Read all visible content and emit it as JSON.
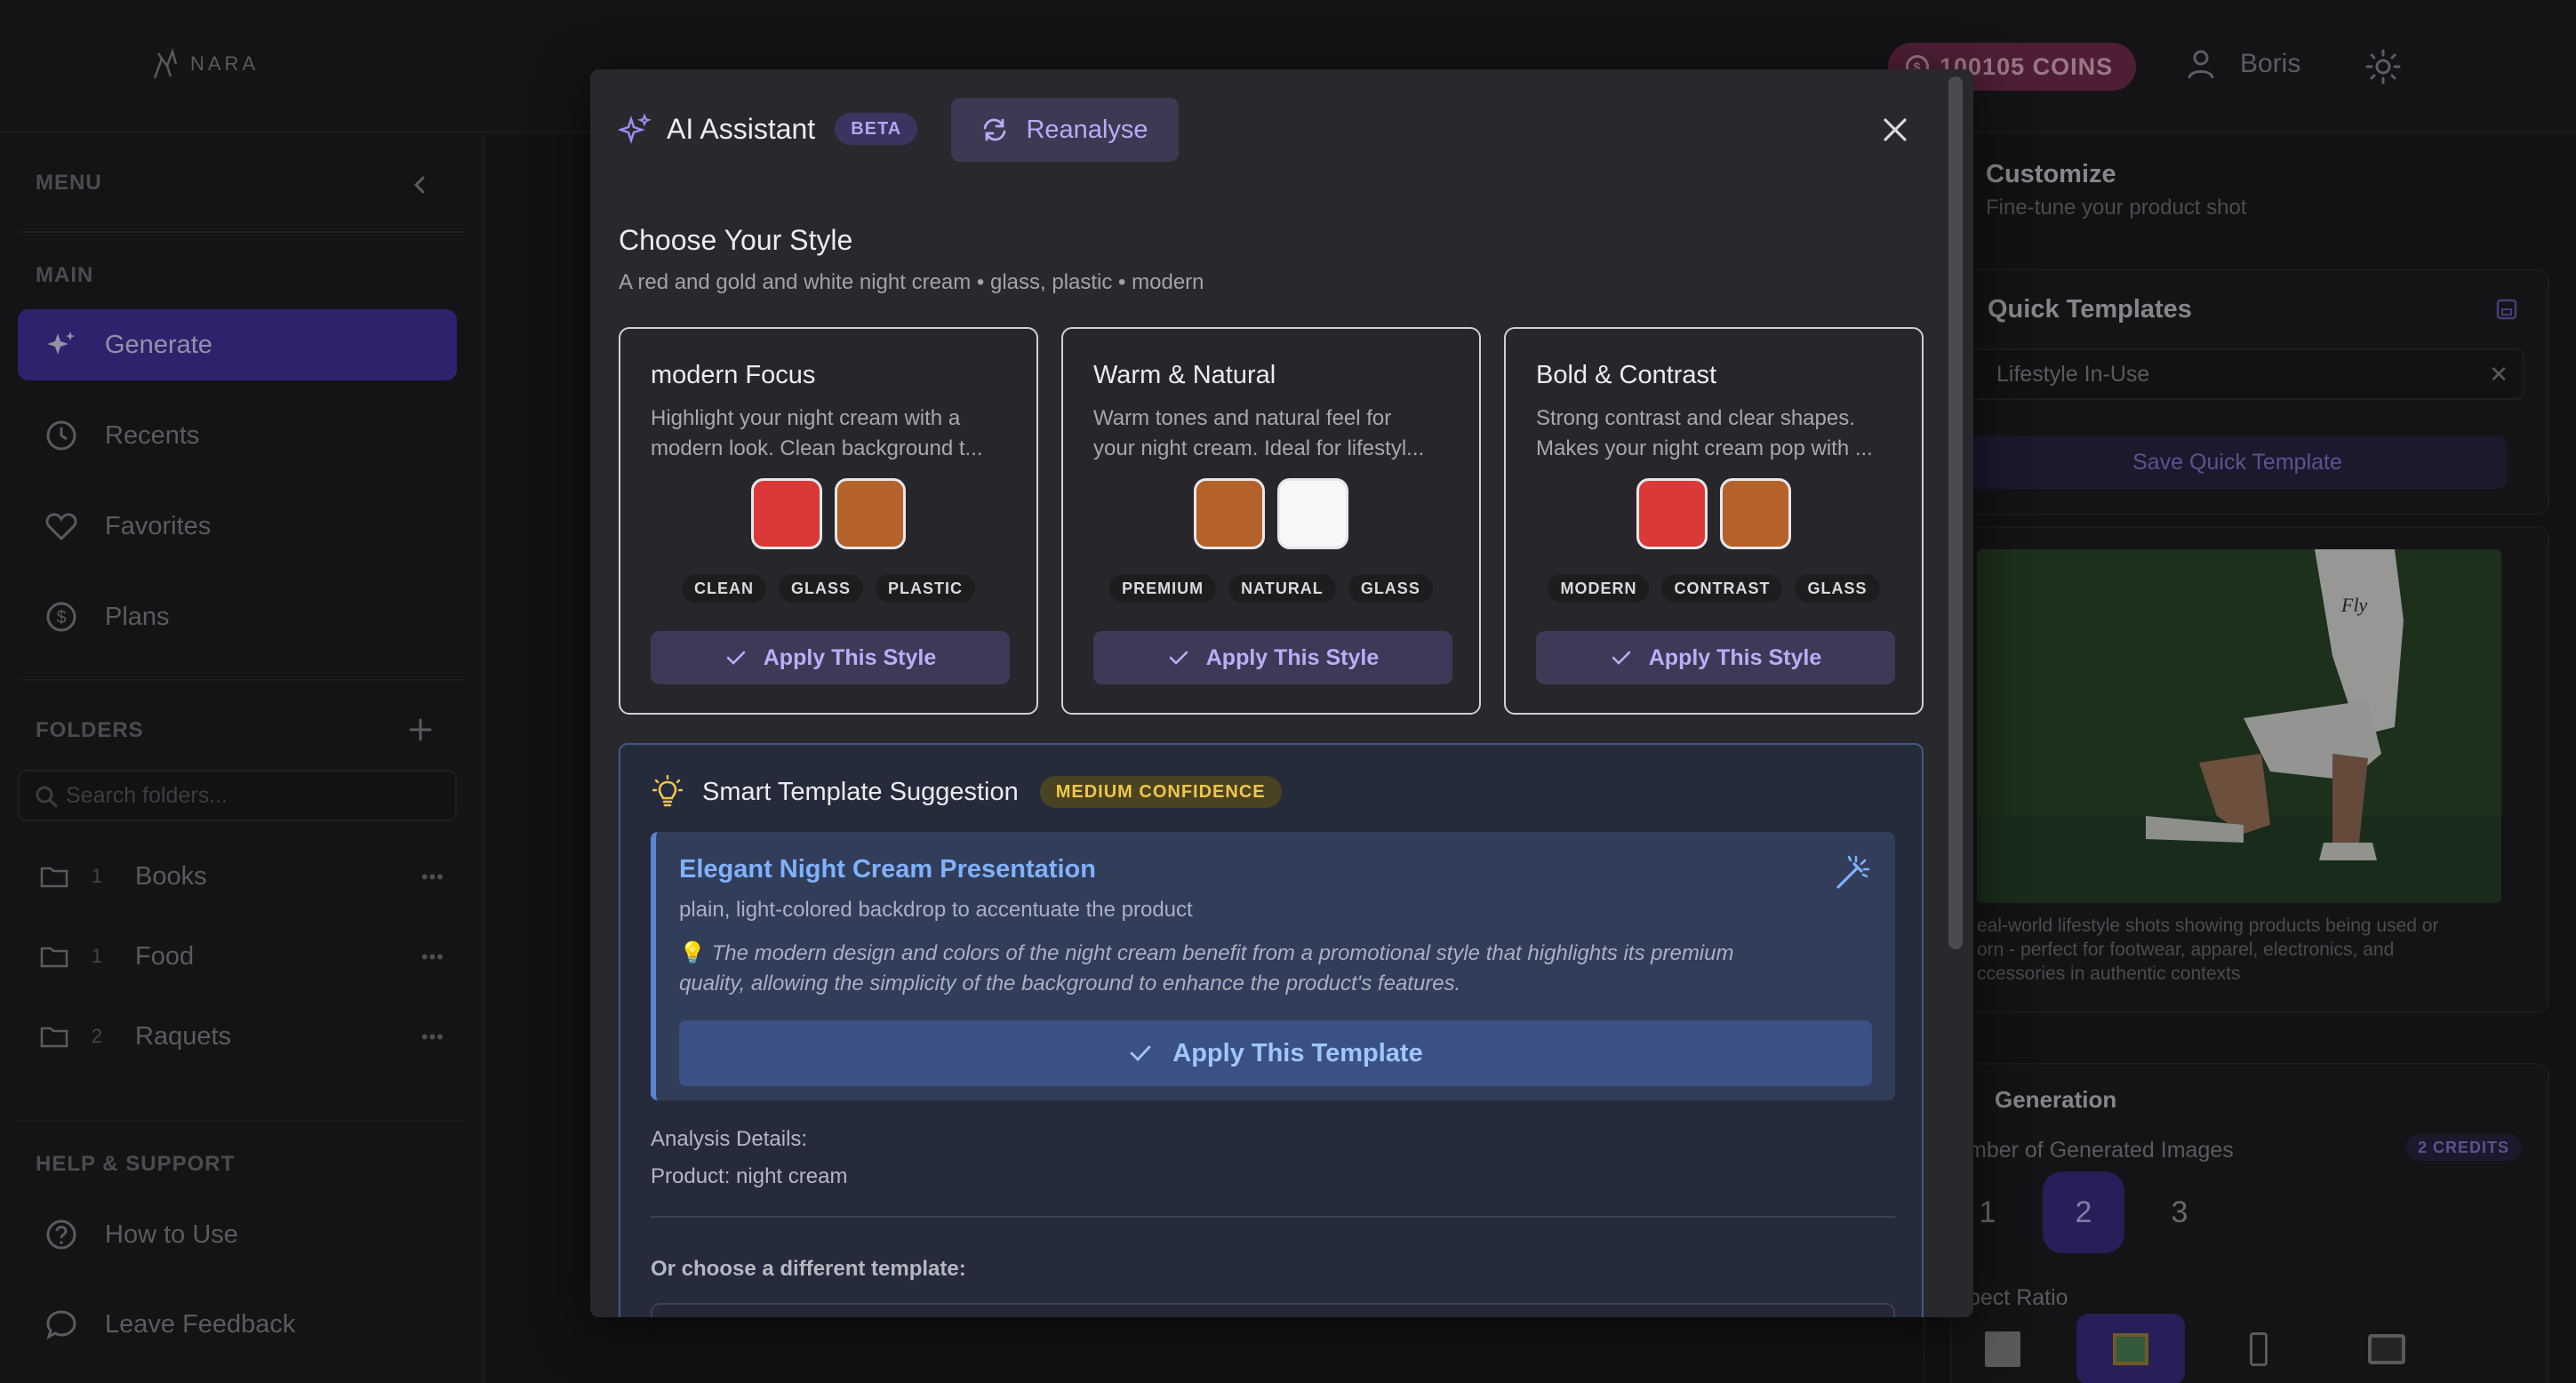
{
  "app": {
    "logo_text": "NARA"
  },
  "header": {
    "coins": "100105 COINS",
    "user_name": "Boris"
  },
  "sidebar": {
    "menu_title": "MENU",
    "main_title": "MAIN",
    "nav": [
      {
        "label": "Generate",
        "icon": "sparkles-icon",
        "active": true
      },
      {
        "label": "Recents",
        "icon": "clock-icon"
      },
      {
        "label": "Favorites",
        "icon": "heart-icon"
      },
      {
        "label": "Plans",
        "icon": "dollar-icon"
      }
    ],
    "folders_title": "FOLDERS",
    "search_placeholder": "Search folders...",
    "folders": [
      {
        "count": "1",
        "name": "Books"
      },
      {
        "count": "1",
        "name": "Food"
      },
      {
        "count": "2",
        "name": "Raquets"
      }
    ],
    "help_title": "HELP & SUPPORT",
    "help": [
      {
        "label": "How to Use",
        "icon": "help-circle-icon"
      },
      {
        "label": "Leave Feedback",
        "icon": "message-icon"
      }
    ]
  },
  "right_panel": {
    "customize_title": "Customize",
    "customize_sub": "Fine-tune your product shot",
    "quick_templates_title": "Quick Templates",
    "selected_template": "Lifestyle In-Use",
    "save_quick_template": "Save Quick Template",
    "template_desc": [
      "eal-world lifestyle shots showing products being used or",
      "orn - perfect for footwear, apparel, electronics, and",
      "ccessories in authentic contexts"
    ],
    "generation_title": "Generation",
    "num_images_label": "mber of Generated Images",
    "credits": "2 CREDITS",
    "counts": [
      "1",
      "2",
      "3"
    ],
    "selected_count": "2",
    "aspect_label": "pect Ratio"
  },
  "modal": {
    "title": "AI Assistant",
    "beta": "BETA",
    "reanalyse": "Reanalyse",
    "choose_title": "Choose Your Style",
    "choose_sub": "A red and gold and white night cream • glass, plastic • modern",
    "styles": [
      {
        "name": "modern Focus",
        "desc_line1": "Highlight your night cream with a",
        "desc_line2": "modern look. Clean background t...",
        "swatches": [
          "#d93a37",
          "#b5622a"
        ],
        "tags": [
          "CLEAN",
          "GLASS",
          "PLASTIC"
        ],
        "button": "Apply This Style"
      },
      {
        "name": "Warm & Natural",
        "desc_line1": "Warm tones and natural feel for",
        "desc_line2": "your night cream. Ideal for lifestyl...",
        "swatches": [
          "#b5622a",
          "#f7f7f8"
        ],
        "tags": [
          "PREMIUM",
          "NATURAL",
          "GLASS"
        ],
        "button": "Apply This Style"
      },
      {
        "name": "Bold & Contrast",
        "desc_line1": "Strong contrast and clear shapes.",
        "desc_line2": "Makes your night cream pop with ...",
        "swatches": [
          "#d93a37",
          "#b5622a"
        ],
        "tags": [
          "MODERN",
          "CONTRAST",
          "GLASS"
        ],
        "button": "Apply This Style"
      }
    ],
    "smart": {
      "title": "Smart Template Suggestion",
      "confidence": "MEDIUM CONFIDENCE",
      "suggestion_title": "Elegant Night Cream Presentation",
      "suggestion_sub": "plain, light-colored backdrop to accentuate the product",
      "note": "The modern design and colors of the night cream benefit from a promotional style that highlights its premium quality, allowing the simplicity of the background to enhance the product's features.",
      "apply_template": "Apply This Template",
      "analysis_label": "Analysis Details:",
      "analysis_product": "Product: night cream",
      "other_label": "Or choose a different template:"
    }
  }
}
